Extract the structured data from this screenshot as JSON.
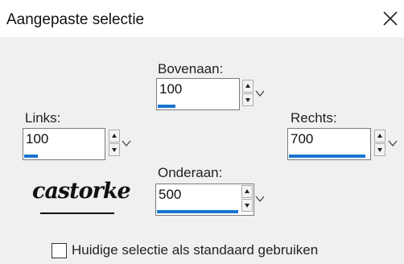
{
  "window": {
    "title": "Aangepaste selectie"
  },
  "fields": {
    "top": {
      "label": "Bovenaan:",
      "value": "100",
      "level": 0.22
    },
    "left": {
      "label": "Links:",
      "value": "100",
      "level": 0.17
    },
    "right": {
      "label": "Rechts:",
      "value": "700",
      "level": 0.95
    },
    "bottom": {
      "label": "Onderaan:",
      "value": "500",
      "level": 0.85
    }
  },
  "logo": {
    "text": "castorke"
  },
  "checkbox": {
    "label": "Huidige selectie als standaard gebruiken",
    "checked": false
  },
  "colors": {
    "accent": "#1874d1",
    "background": "#f0f0f0",
    "titlebar": "#ffffff"
  },
  "icons": [
    "close-icon",
    "spin-up-icon",
    "spin-down-icon",
    "chevron-down-icon"
  ]
}
